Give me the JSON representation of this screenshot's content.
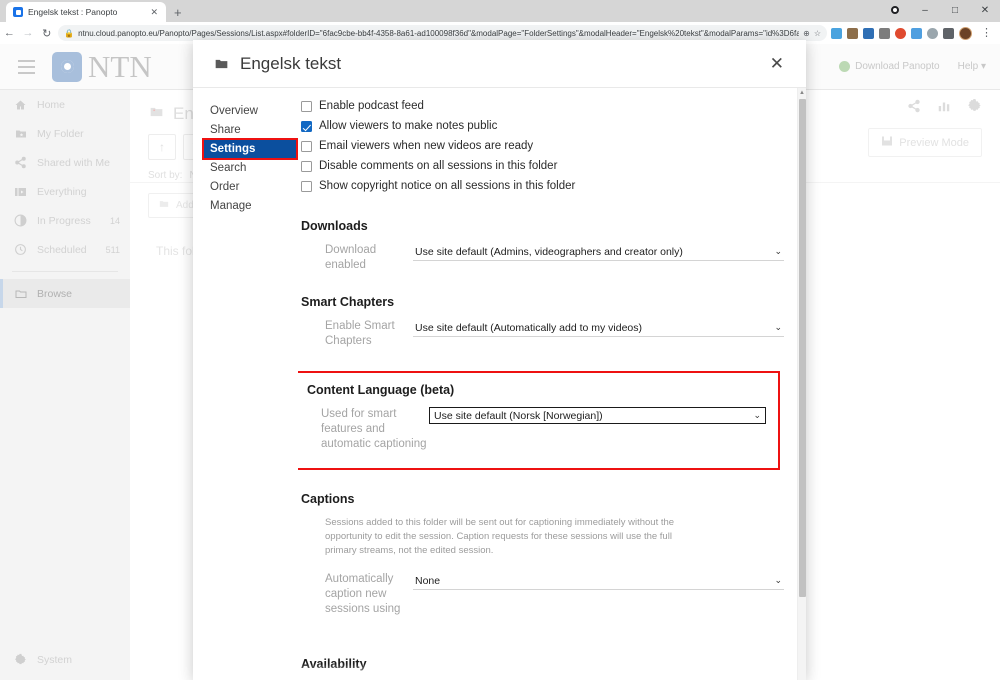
{
  "browser": {
    "tab": {
      "title": "Engelsk tekst : Panopto",
      "close_label": "✕",
      "favicon": "panopto-favicon"
    },
    "new_tab_label": "+",
    "window_controls": {
      "minimize": "–",
      "maximize": "□",
      "close": "✕"
    },
    "nav": {
      "back": "←",
      "forward": "→",
      "reload": "↻"
    },
    "omnibox": {
      "lock": "🔒",
      "url": "ntnu.cloud.panopto.eu/Panopto/Pages/Sessions/List.aspx#folderID=\"6fac9cbe-bb4f-4358-8a61-ad100098f36d\"&modalPage=\"FolderSettings\"&modalHeader=\"Engelsk%20tekst\"&modalParams=\"id%3D6fac9cbe-bb4f-4358-8a61-ad100098f3...",
      "zoom_icon": "⊕",
      "bookmark_icon": "☆"
    },
    "extensions": [
      "lock-ext-icon",
      "brush-ext-icon",
      "note-ext-icon",
      "mask-ext-icon",
      "adblock-ext-icon",
      "translate-ext-icon",
      "globe-ext-icon",
      "puzzle-ext-icon"
    ],
    "profile": "user-avatar",
    "menu": "⋮"
  },
  "app": {
    "menu_toggle": "hamburger-menu",
    "brand_text": "NTN",
    "header_right": {
      "download_label": "Download Panopto",
      "help_label": "Help ▾"
    },
    "sidebar": {
      "items": [
        {
          "label": "Home",
          "icon": "home-icon",
          "count": ""
        },
        {
          "label": "My Folder",
          "icon": "my-folder-icon",
          "count": ""
        },
        {
          "label": "Shared with Me",
          "icon": "share-icon",
          "count": ""
        },
        {
          "label": "Everything",
          "icon": "everything-icon",
          "count": ""
        },
        {
          "label": "In Progress",
          "icon": "in-progress-icon",
          "count": "14"
        },
        {
          "label": "Scheduled",
          "icon": "clock-icon",
          "count": "511"
        },
        {
          "label": "Browse",
          "icon": "folder-icon",
          "count": ""
        }
      ],
      "system_label": "System",
      "system_icon": "gear-icon"
    },
    "content": {
      "folder_title": "Engel",
      "sort_label": "Sort by:",
      "sort_value": "Na",
      "add_folder_label": "Add fol",
      "empty_text": "This fol",
      "preview_label": "Preview Mode",
      "actions": [
        "share-icon",
        "stats-icon",
        "settings-gear-icon"
      ]
    }
  },
  "modal": {
    "title": "Engelsk tekst",
    "folder_icon": "folder-icon",
    "close_label": "✕",
    "nav": [
      {
        "label": "Overview",
        "active": false
      },
      {
        "label": "Share",
        "active": false
      },
      {
        "label": "Settings",
        "active": true
      },
      {
        "label": "Search",
        "active": false
      },
      {
        "label": "Order",
        "active": false
      },
      {
        "label": "Manage",
        "active": false
      }
    ],
    "checkboxes": [
      {
        "label": "Enable podcast feed",
        "checked": false
      },
      {
        "label": "Allow viewers to make notes public",
        "checked": true
      },
      {
        "label": "Email viewers when new videos are ready",
        "checked": false
      },
      {
        "label": "Disable comments on all sessions in this folder",
        "checked": false
      },
      {
        "label": "Show copyright notice on all sessions in this folder",
        "checked": false
      }
    ],
    "downloads": {
      "heading": "Downloads",
      "field_label": "Download enabled",
      "value": "Use site default (Admins, videographers and creator only)",
      "caret": "⌄"
    },
    "smart_chapters": {
      "heading": "Smart Chapters",
      "field_label": "Enable Smart Chapters",
      "value": "Use site default (Automatically add to my videos)",
      "caret": "⌄"
    },
    "content_language": {
      "heading": "Content Language (beta)",
      "field_label": "Used for smart features and automatic captioning",
      "value": "Use site default (Norsk [Norwegian])",
      "caret": "⌄",
      "highlight_color": "#ee1111"
    },
    "captions": {
      "heading": "Captions",
      "note": "Sessions added to this folder will be sent out for captioning immediately without the opportunity to edit the session. Caption requests for these sessions will use the full primary streams, not the edited session.",
      "field_label": "Automatically caption new sessions using",
      "value": "None",
      "caret": "⌄"
    },
    "availability": {
      "heading": "Availability"
    },
    "scrollbar": {
      "up_arrow": "▲"
    }
  }
}
